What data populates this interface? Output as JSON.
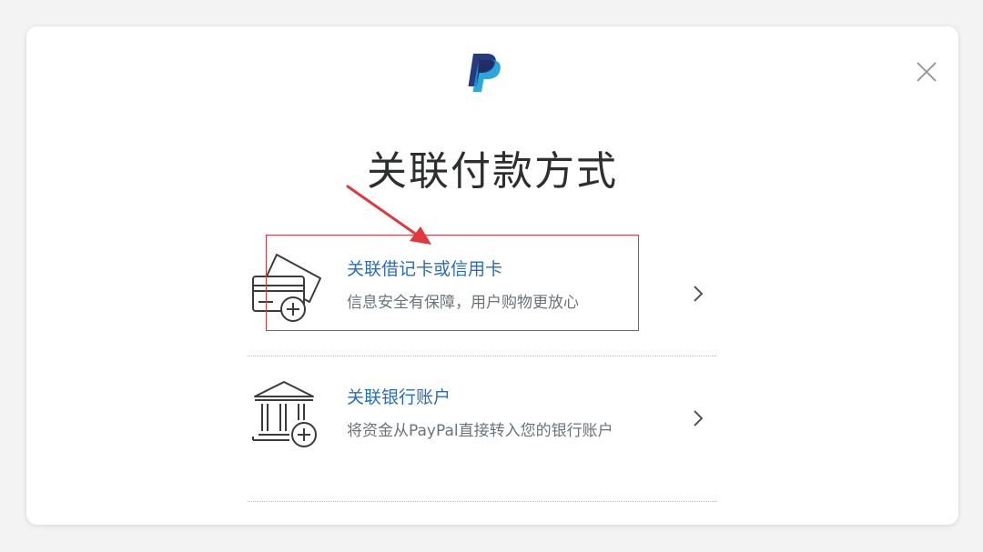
{
  "dialog": {
    "brand_icon": "paypal-logo",
    "close_icon": "close-icon",
    "title": "关联付款方式"
  },
  "options": [
    {
      "icon": "card-add-icon",
      "title": "关联借记卡或信用卡",
      "description": "信息安全有保障，用户购物更放心"
    },
    {
      "icon": "bank-add-icon",
      "title": "关联银行账户",
      "description": "将资金从PayPal直接转入您的银行账户"
    }
  ],
  "annotation": {
    "highlight_color": "#e0383c",
    "target": "关联借记卡或信用卡"
  },
  "colors": {
    "link_blue": "#2a6cbd",
    "paypal_dark": "#253b80",
    "paypal_light": "#179bd7",
    "text_gray": "#6c7378"
  }
}
